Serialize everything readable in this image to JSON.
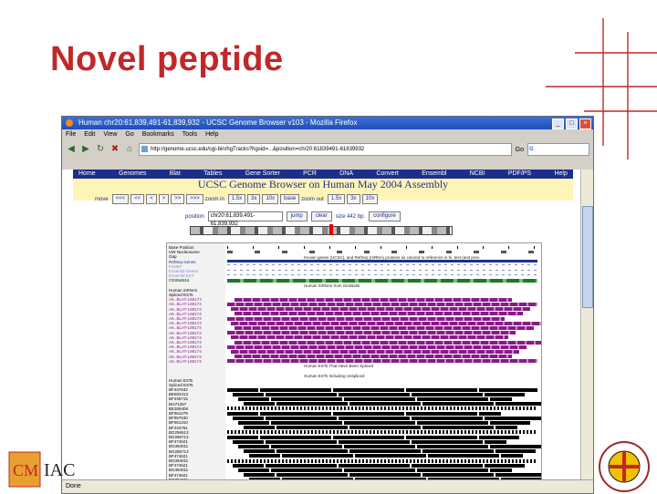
{
  "slide": {
    "title": "Novel peptide",
    "logo_text": "CMIAC"
  },
  "browser": {
    "window_title": "Human chr20:61,839,491-61,839,932 - UCSC Genome Browser v103 - Mozilla Firefox",
    "menu": [
      "File",
      "Edit",
      "View",
      "Go",
      "Bookmarks",
      "Tools",
      "Help"
    ],
    "url": "http://genome.ucsc.edu/cgi-bin/hgTracks?hgsid=...&position=chr20:61839491-61839932",
    "go_label": "Go",
    "search_placeholder": "",
    "status": "Done"
  },
  "ucsc": {
    "nav": [
      "Home",
      "Genomes",
      "Blat",
      "Tables",
      "Gene Sorter",
      "PCR",
      "DNA",
      "Convert",
      "Ensembl",
      "NCBI",
      "PDF/PS",
      "Help"
    ],
    "header_line1": "UCSC Genome Browser on Human May 2004 Assembly",
    "move_label": "move",
    "move_buttons": [
      "<<<",
      "<<",
      "<",
      ">",
      ">>",
      ">>>"
    ],
    "zoom_in_label": "zoom in",
    "zoom_in_buttons": [
      "1.5x",
      "3x",
      "10x",
      "base"
    ],
    "zoom_out_label": "zoom out",
    "zoom_out_buttons": [
      "1.5x",
      "3x",
      "10x"
    ],
    "position_label": "position",
    "position_value": "chr20:61,839,491-61,839,932",
    "jump_label": "jump",
    "clear_label": "clear",
    "size_label": "size 442 bp.",
    "configure_label": "configure",
    "tracks": [
      {
        "label": "Base Position",
        "color": "#000000",
        "kind": "ruler"
      },
      {
        "label": "UW Nucleosome",
        "color": "#000000",
        "kind": "sparse"
      },
      {
        "label": "Gap",
        "color": "#000000",
        "kind": "empty"
      },
      {
        "label": "RefSeq Genes",
        "color": "#1e2f8a",
        "kind": "gene"
      },
      {
        "label": "FirstEF",
        "color": "#8a8ac8",
        "kind": "thin"
      },
      {
        "label": "Ensembl Genes",
        "color": "#8a8ac8",
        "kind": "thin"
      },
      {
        "label": "Ensembl EST",
        "color": "#8a8ac8",
        "kind": "thin"
      },
      {
        "label": "CDS54534",
        "color": "#1a7a2a",
        "kind": "green"
      },
      {
        "label": "",
        "color": "#000000",
        "kind": "empty"
      },
      {
        "label": "Human mRNAs",
        "color": "#000000",
        "kind": "empty"
      },
      {
        "label": "Spliced ESTs",
        "color": "#000000",
        "kind": "empty"
      },
      {
        "label": "AK..BLAT-L98174",
        "color": "#8a1a8a",
        "kind": "purple"
      },
      {
        "label": "AK..BLAT-L98174",
        "color": "#8a1a8a",
        "kind": "purple"
      },
      {
        "label": "AK..BLAT-L98174",
        "color": "#8a1a8a",
        "kind": "purple"
      },
      {
        "label": "AK..BLAT-L98174",
        "color": "#8a1a8a",
        "kind": "purple"
      },
      {
        "label": "AK..BLAT-L98174",
        "color": "#8a1a8a",
        "kind": "purple"
      },
      {
        "label": "AK..BLAT-L98174",
        "color": "#8a1a8a",
        "kind": "purple"
      },
      {
        "label": "AK..BLAT-L98174",
        "color": "#8a1a8a",
        "kind": "purple"
      },
      {
        "label": "AK..BLAT-L98174",
        "color": "#8a1a8a",
        "kind": "purple"
      },
      {
        "label": "AK..BLAT-L98174",
        "color": "#8a1a8a",
        "kind": "purple"
      },
      {
        "label": "AK..BLAT-L98174",
        "color": "#8a1a8a",
        "kind": "purple"
      },
      {
        "label": "AK..BLAT-L98174",
        "color": "#8a1a8a",
        "kind": "purple"
      },
      {
        "label": "AK..BLAT-L98174",
        "color": "#8a1a8a",
        "kind": "purple"
      },
      {
        "label": "AK..BLAT-L98174",
        "color": "#8a1a8a",
        "kind": "purple"
      },
      {
        "label": "AK..BLAT-L98174",
        "color": "#8a1a8a",
        "kind": "purple"
      },
      {
        "label": "",
        "color": "#000000",
        "kind": "empty"
      },
      {
        "label": "",
        "color": "#000000",
        "kind": "empty"
      },
      {
        "label": "",
        "color": "#000000",
        "kind": "empty"
      },
      {
        "label": "Human ESTs",
        "color": "#000000",
        "kind": "empty"
      },
      {
        "label": "Spliced ESTs",
        "color": "#000000",
        "kind": "empty"
      },
      {
        "label": "BF437632",
        "color": "#000000",
        "kind": "black"
      },
      {
        "label": "BE503413",
        "color": "#000000",
        "kind": "black"
      },
      {
        "label": "BF435715",
        "color": "#000000",
        "kind": "black"
      },
      {
        "label": "BI471267",
        "color": "#000000",
        "kind": "black"
      },
      {
        "label": "BE309408",
        "color": "#000000",
        "kind": "dotted"
      },
      {
        "label": "BF061279",
        "color": "#000000",
        "kind": "black"
      },
      {
        "label": "BF057530",
        "color": "#000000",
        "kind": "black"
      },
      {
        "label": "BF061310",
        "color": "#000000",
        "kind": "black"
      },
      {
        "label": "BF434751",
        "color": "#000000",
        "kind": "black"
      },
      {
        "label": "BG256513",
        "color": "#000000",
        "kind": "dotted"
      },
      {
        "label": "BG286713",
        "color": "#000000",
        "kind": "black"
      },
      {
        "label": "BF474621",
        "color": "#000000",
        "kind": "black"
      },
      {
        "label": "BG394011",
        "color": "#000000",
        "kind": "black"
      },
      {
        "label": "BG286713",
        "color": "#000000",
        "kind": "black"
      },
      {
        "label": "BF474621",
        "color": "#000000",
        "kind": "black"
      },
      {
        "label": "BG394011",
        "color": "#000000",
        "kind": "dotted"
      },
      {
        "label": "BF474621",
        "color": "#000000",
        "kind": "black"
      },
      {
        "label": "BG394011",
        "color": "#000000",
        "kind": "black"
      },
      {
        "label": "BF474621",
        "color": "#000000",
        "kind": "black"
      },
      {
        "label": "BG394011",
        "color": "#000000",
        "kind": "black"
      }
    ],
    "notes": {
      "refseq_text": "Known genes (UCSC), and RefSeq (mRNA) proteins as colored to reference in hi. text (and prev.",
      "mrna_text": "Human mRNAs from GenBank",
      "spliced_text": "Human ESTs That Have Been Spliced",
      "est_text": "Human ESTs Including Unspliced"
    }
  }
}
